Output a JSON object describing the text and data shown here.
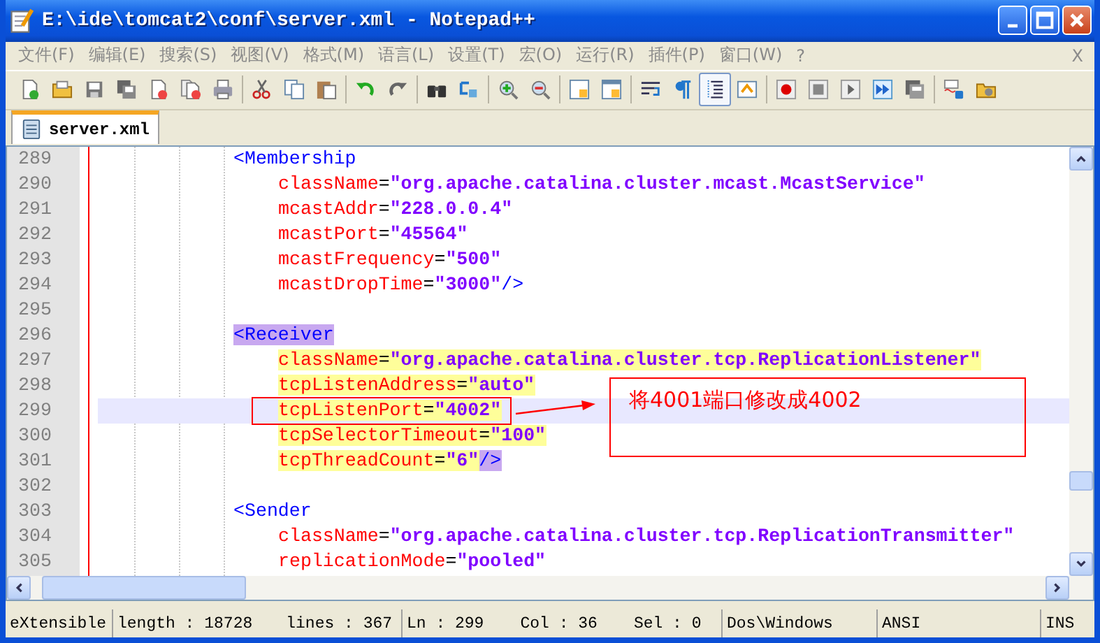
{
  "window": {
    "title": "E:\\ide\\tomcat2\\conf\\server.xml - Notepad++"
  },
  "menu": {
    "items": [
      "文件(F)",
      "编辑(E)",
      "搜索(S)",
      "视图(V)",
      "格式(M)",
      "语言(L)",
      "设置(T)",
      "宏(O)",
      "运行(R)",
      "插件(P)",
      "窗口(W)",
      "?"
    ],
    "close": "X"
  },
  "toolbar": {
    "buttons": [
      {
        "pressed": false
      },
      {
        "pressed": false
      },
      {
        "pressed": false
      },
      {
        "pressed": false
      },
      {
        "pressed": false
      },
      {
        "pressed": false
      },
      {
        "pressed": false
      },
      {
        "pressed": false
      },
      {
        "pressed": false
      },
      {
        "pressed": false
      },
      {
        "pressed": false
      },
      {
        "pressed": false
      },
      {
        "pressed": false
      },
      {
        "pressed": false
      },
      {
        "pressed": false
      },
      {
        "pressed": false
      },
      {
        "pressed": false
      },
      {
        "pressed": false
      },
      {
        "pressed": false
      },
      {
        "pressed": false
      },
      {
        "pressed": true
      },
      {
        "pressed": false
      },
      {
        "pressed": false
      },
      {
        "pressed": false
      },
      {
        "pressed": false
      },
      {
        "pressed": false
      },
      {
        "pressed": false
      },
      {
        "pressed": false
      },
      {
        "pressed": false
      }
    ]
  },
  "tabs": [
    {
      "label": "server.xml",
      "selected": true
    }
  ],
  "editor": {
    "lines": [
      {
        "number": "289",
        "kind": "tag",
        "current": false,
        "highlighted": false,
        "tokens": [
          {
            "kind": "tag",
            "text": "<Membership",
            "matched": false
          }
        ]
      },
      {
        "number": "290",
        "kind": "attribute",
        "current": false,
        "highlighted": false,
        "tokens": [
          {
            "kind": "attr",
            "text": "className",
            "matched": false
          },
          {
            "kind": "eq",
            "text": "=",
            "matched": false
          },
          {
            "kind": "value",
            "text": "\"org.apache.catalina.cluster.mcast.McastService\"",
            "matched": false
          }
        ]
      },
      {
        "number": "291",
        "kind": "attribute",
        "current": false,
        "highlighted": false,
        "tokens": [
          {
            "kind": "attr",
            "text": "mcastAddr",
            "matched": false
          },
          {
            "kind": "eq",
            "text": "=",
            "matched": false
          },
          {
            "kind": "value",
            "text": "\"228.0.0.4\"",
            "matched": false
          }
        ]
      },
      {
        "number": "292",
        "kind": "attribute",
        "current": false,
        "highlighted": false,
        "tokens": [
          {
            "kind": "attr",
            "text": "mcastPort",
            "matched": false
          },
          {
            "kind": "eq",
            "text": "=",
            "matched": false
          },
          {
            "kind": "value",
            "text": "\"45564\"",
            "matched": false
          }
        ]
      },
      {
        "number": "293",
        "kind": "attribute",
        "current": false,
        "highlighted": false,
        "tokens": [
          {
            "kind": "attr",
            "text": "mcastFrequency",
            "matched": false
          },
          {
            "kind": "eq",
            "text": "=",
            "matched": false
          },
          {
            "kind": "value",
            "text": "\"500\"",
            "matched": false
          }
        ]
      },
      {
        "number": "294",
        "kind": "attribute",
        "current": false,
        "highlighted": false,
        "tokens": [
          {
            "kind": "attr",
            "text": "mcastDropTime",
            "matched": false
          },
          {
            "kind": "eq",
            "text": "=",
            "matched": false
          },
          {
            "kind": "value",
            "text": "\"3000\"",
            "matched": false
          },
          {
            "kind": "tag",
            "text": "/>",
            "matched": false
          }
        ]
      },
      {
        "number": "295",
        "kind": "blank",
        "current": false
      },
      {
        "number": "296",
        "kind": "tag",
        "current": false,
        "highlighted": false,
        "tokens": [
          {
            "kind": "tag",
            "text": "<Receiver",
            "matched": true
          }
        ]
      },
      {
        "number": "297",
        "kind": "attribute",
        "current": false,
        "highlighted": true,
        "tokens": [
          {
            "kind": "attr",
            "text": "className",
            "matched": false
          },
          {
            "kind": "eq",
            "text": "=",
            "matched": false
          },
          {
            "kind": "value",
            "text": "\"org.apache.catalina.cluster.tcp.ReplicationListener\"",
            "matched": false
          }
        ]
      },
      {
        "number": "298",
        "kind": "attribute",
        "current": false,
        "highlighted": true,
        "tokens": [
          {
            "kind": "attr",
            "text": "tcpListenAddress",
            "matched": false
          },
          {
            "kind": "eq",
            "text": "=",
            "matched": false
          },
          {
            "kind": "value",
            "text": "\"auto\"",
            "matched": false
          }
        ]
      },
      {
        "number": "299",
        "kind": "attribute",
        "current": true,
        "highlighted": true,
        "tokens": [
          {
            "kind": "attr",
            "text": "tcpListenPort",
            "matched": false
          },
          {
            "kind": "eq",
            "text": "=",
            "matched": false
          },
          {
            "kind": "value",
            "text": "\"4002\"",
            "matched": false
          }
        ]
      },
      {
        "number": "300",
        "kind": "attribute",
        "current": false,
        "highlighted": true,
        "tokens": [
          {
            "kind": "attr",
            "text": "tcpSelectorTimeout",
            "matched": false
          },
          {
            "kind": "eq",
            "text": "=",
            "matched": false
          },
          {
            "kind": "value",
            "text": "\"100\"",
            "matched": false
          }
        ]
      },
      {
        "number": "301",
        "kind": "attribute",
        "current": false,
        "highlighted": true,
        "tokens": [
          {
            "kind": "attr",
            "text": "tcpThreadCount",
            "matched": false
          },
          {
            "kind": "eq",
            "text": "=",
            "matched": false
          },
          {
            "kind": "value",
            "text": "\"6\"",
            "matched": false
          },
          {
            "kind": "tag",
            "text": "/>",
            "matched": true
          }
        ]
      },
      {
        "number": "302",
        "kind": "blank",
        "current": false
      },
      {
        "number": "303",
        "kind": "tag",
        "current": false,
        "highlighted": false,
        "tokens": [
          {
            "kind": "tag",
            "text": "<Sender",
            "matched": false
          }
        ]
      },
      {
        "number": "304",
        "kind": "attribute",
        "current": false,
        "highlighted": false,
        "tokens": [
          {
            "kind": "attr",
            "text": "className",
            "matched": false
          },
          {
            "kind": "eq",
            "text": "=",
            "matched": false
          },
          {
            "kind": "value",
            "text": "\"org.apache.catalina.cluster.tcp.ReplicationTransmitter\"",
            "matched": false
          }
        ]
      },
      {
        "number": "305",
        "kind": "attribute",
        "current": false,
        "highlighted": false,
        "tokens": [
          {
            "kind": "attr",
            "text": "replicationMode",
            "matched": false
          },
          {
            "kind": "eq",
            "text": "=",
            "matched": false
          },
          {
            "kind": "value",
            "text": "\"pooled\"",
            "matched": false
          }
        ]
      }
    ]
  },
  "annotation": {
    "note": "将4001端口修改成4002"
  },
  "status_bar": {
    "cells": [
      [
        "eXtensible"
      ],
      [
        "length : 18728",
        "lines : 367"
      ],
      [
        "Ln : 299",
        "Col : 36",
        "Sel : 0"
      ],
      [
        "Dos\\Windows"
      ],
      [
        "ANSI"
      ],
      [
        "INS"
      ]
    ]
  }
}
